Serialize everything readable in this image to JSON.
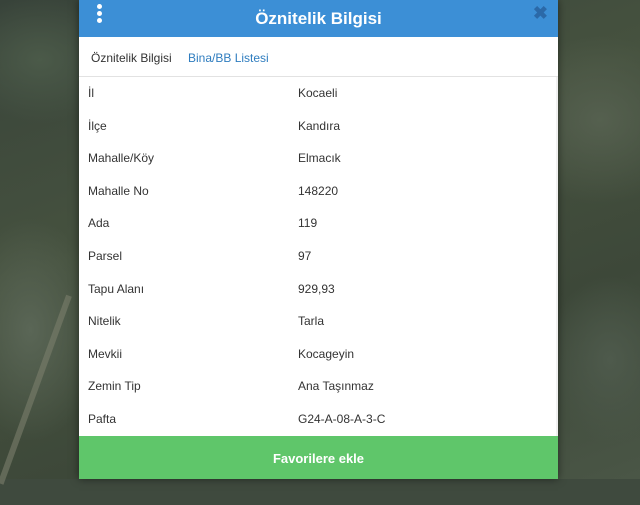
{
  "header": {
    "title": "Öznitelik Bilgisi",
    "close_symbol": "✖"
  },
  "tabs": [
    {
      "label": "Öznitelik Bilgisi",
      "active": true
    },
    {
      "label": "Bina/BB Listesi",
      "active": false
    }
  ],
  "attributes": [
    {
      "key": "İl",
      "value": "Kocaeli"
    },
    {
      "key": "İlçe",
      "value": "Kandıra"
    },
    {
      "key": "Mahalle/Köy",
      "value": "Elmacık"
    },
    {
      "key": "Mahalle No",
      "value": "148220"
    },
    {
      "key": "Ada",
      "value": "119"
    },
    {
      "key": "Parsel",
      "value": "97"
    },
    {
      "key": "Tapu Alanı",
      "value": "929,93"
    },
    {
      "key": "Nitelik",
      "value": "Tarla"
    },
    {
      "key": "Mevkii",
      "value": "Kocageyin"
    },
    {
      "key": "Zemin Tip",
      "value": "Ana Taşınmaz"
    },
    {
      "key": "Pafta",
      "value": "G24-A-08-A-3-C"
    }
  ],
  "footer": {
    "button_label": "Favorilere ekle"
  },
  "colors": {
    "header": "#3c8fd6",
    "footer_button": "#5fc66a",
    "active_tab_link": "#2f7dbf"
  }
}
